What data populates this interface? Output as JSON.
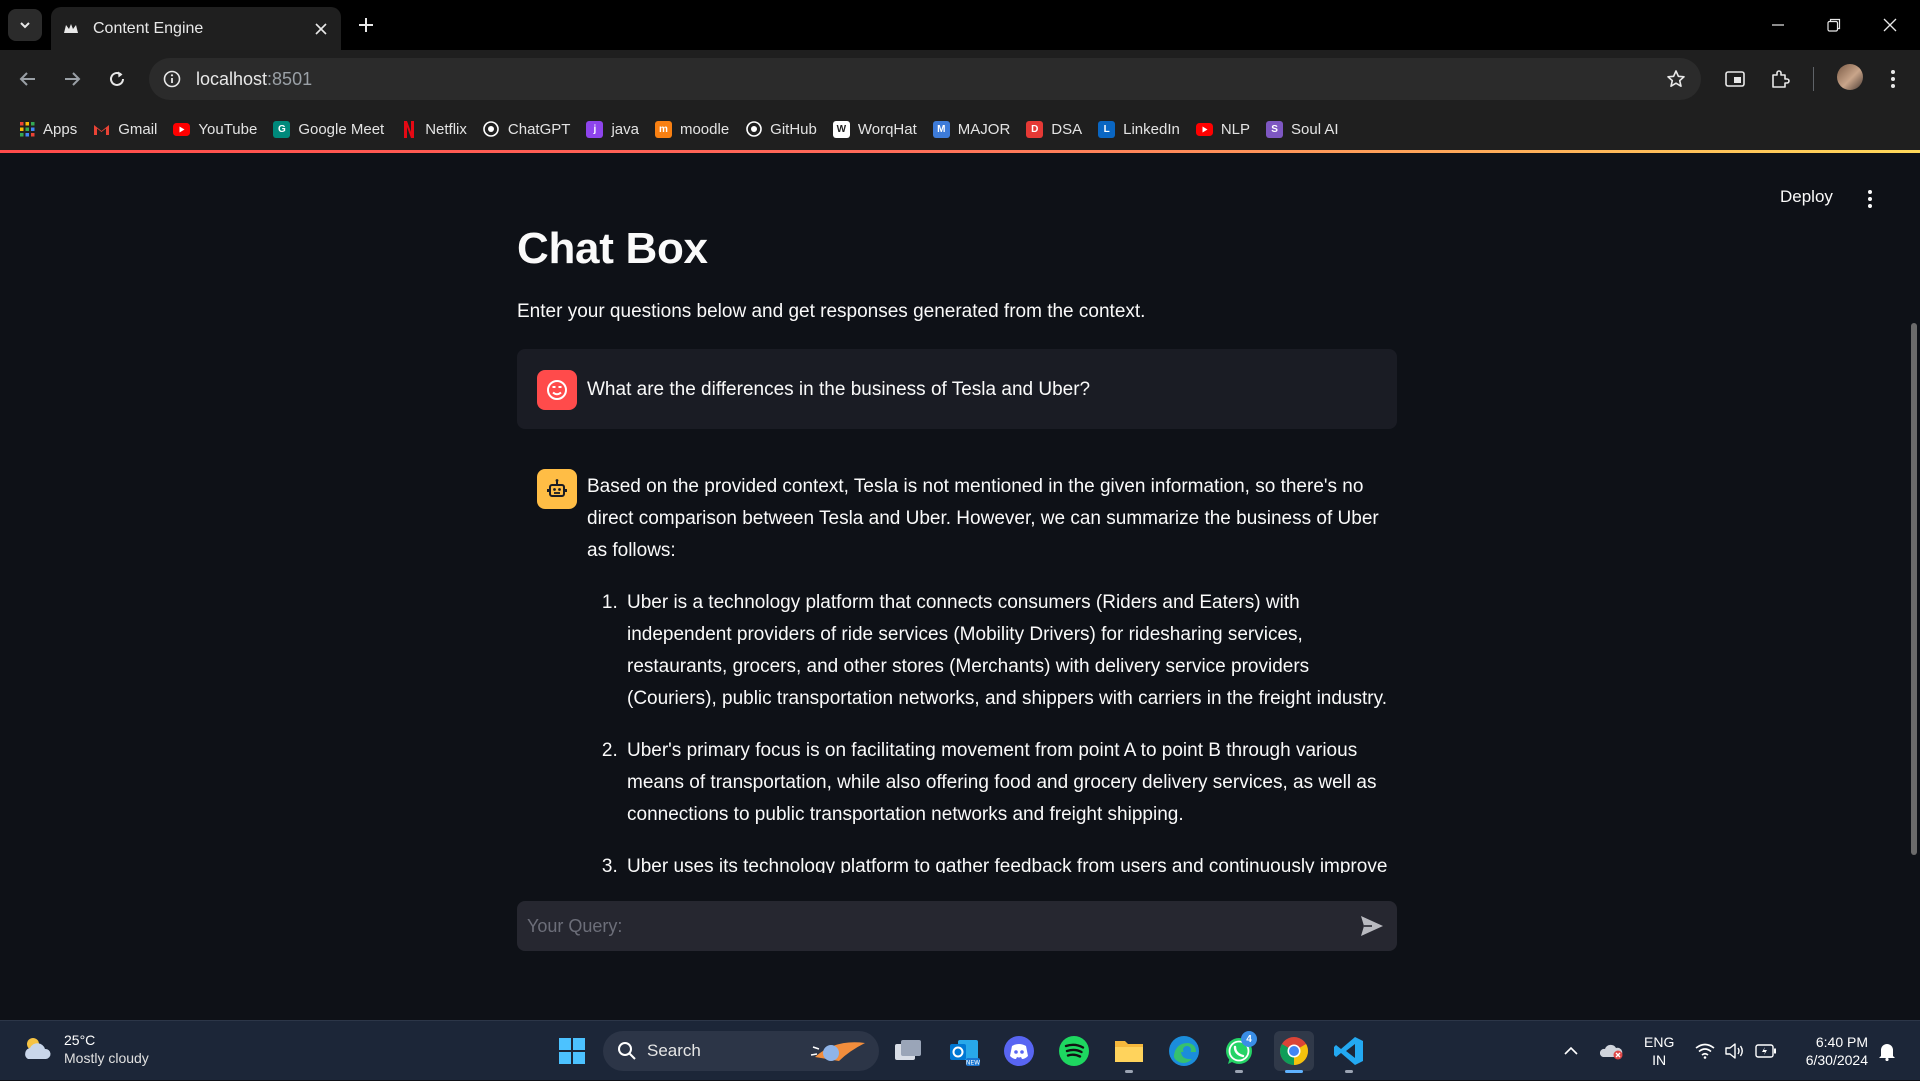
{
  "browser": {
    "tab_title": "Content Engine",
    "url_host": "localhost",
    "url_port": ":8501",
    "bookmarks": [
      {
        "label": "Apps",
        "icon": "apps-grid-icon",
        "color": "#4285f4"
      },
      {
        "label": "Gmail",
        "icon": "gmail-icon",
        "color": "#ea4335"
      },
      {
        "label": "YouTube",
        "icon": "youtube-icon",
        "color": "#ff0000"
      },
      {
        "label": "Google Meet",
        "icon": "google-meet-icon",
        "color": "#00897b"
      },
      {
        "label": "Netflix",
        "icon": "netflix-icon",
        "color": "#e50914"
      },
      {
        "label": "ChatGPT",
        "icon": "chatgpt-icon",
        "color": "#ffffff"
      },
      {
        "label": "java",
        "icon": "java-icon",
        "color": "#8e44ec"
      },
      {
        "label": "moodle",
        "icon": "moodle-icon",
        "color": "#f98012"
      },
      {
        "label": "GitHub",
        "icon": "github-icon",
        "color": "#ffffff"
      },
      {
        "label": "WorqHat",
        "icon": "worqhat-icon",
        "color": "#ffffff"
      },
      {
        "label": "MAJOR",
        "icon": "major-icon",
        "color": "#3d7bd9"
      },
      {
        "label": "DSA",
        "icon": "dsa-icon",
        "color": "#e53935"
      },
      {
        "label": "LinkedIn",
        "icon": "linkedin-icon",
        "color": "#0a66c2"
      },
      {
        "label": "NLP",
        "icon": "youtube-icon",
        "color": "#ff0000"
      },
      {
        "label": "Soul AI",
        "icon": "soul-ai-icon",
        "color": "#7e57c2"
      }
    ]
  },
  "app": {
    "deploy_label": "Deploy",
    "title": "Chat Box",
    "caption": "Enter your questions below and get responses generated from the context.",
    "user_message": "What are the differences in the business of Tesla and Uber?",
    "assistant_intro": "Based on the provided context, Tesla is not mentioned in the given information, so there's no direct comparison between Tesla and Uber. However, we can summarize the business of Uber as follows:",
    "assistant_points": [
      "Uber is a technology platform that connects consumers (Riders and Eaters) with independent providers of ride services (Mobility Drivers) for ridesharing services, restaurants, grocers, and other stores (Merchants) with delivery service providers (Couriers), public transportation networks, and shippers with carriers in the freight industry.",
      "Uber's primary focus is on facilitating movement from point A to point B through various means of transportation, while also offering food and grocery delivery services, as well as connections to public transportation networks and freight shipping.",
      "Uber uses its technology platform to gather feedback from users and continuously improve"
    ],
    "input_placeholder": "Your Query:",
    "accent_user": "#ff4b4b",
    "accent_bot": "#ffbd45"
  },
  "taskbar": {
    "temperature": "25°C",
    "weather": "Mostly cloudy",
    "search_label": "Search",
    "whatsapp_badge": "4",
    "lang_top": "ENG",
    "lang_bottom": "IN",
    "time": "6:40 PM",
    "date": "6/30/2024"
  }
}
